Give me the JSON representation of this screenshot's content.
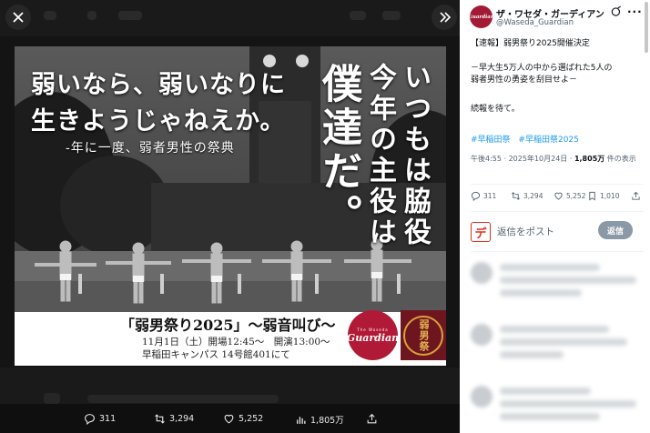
{
  "viewer": {
    "close_icon": "close-icon",
    "expand_icon": "double-chevron-right-icon",
    "poster": {
      "headline": "弱いなら、弱いなりに\n生きようじゃねえか。",
      "subline": "-年に一度、弱者男性の祭典",
      "vertical_1": "いつもは脇役",
      "vertical_2": "今年の主役は",
      "vertical_3": "僕達だ。",
      "event_title": "「弱男祭り2025」～弱音叫び～",
      "event_line_1": "11月1日（土）開場12:45～　開演13:00～",
      "event_line_2": "早稲田キャンパス 14号館401にて",
      "logo_small": "The Waseda",
      "logo_big": "Guardian",
      "logo_seal": "弱男祭"
    },
    "actions": {
      "replies": "311",
      "reposts": "3,294",
      "likes": "5,252",
      "views": "1,805万"
    }
  },
  "panel": {
    "account_name": "ザ・ワセダ・ガーディアン",
    "account_handle": "@Waseda_Guardian",
    "avatar_text": "Guardian",
    "post_line_1": "【速報】弱男祭り2025開催決定",
    "post_line_2": "－早大生5万人の中から選ばれた5人の",
    "post_line_3": "弱者男性の勇姿を刮目せよ－",
    "post_line_4": "続報を待て。",
    "hashtags": [
      "#早稲田祭",
      "#早稲田祭2025"
    ],
    "timestamp": "午後4:55 · 2025年10月24日 · ",
    "views_count": "1,805万",
    "views_label": " 件の表示",
    "stats": {
      "replies": "311",
      "reposts": "3,294",
      "likes": "5,252",
      "bookmarks": "1,010"
    },
    "reply_avatar": "デ",
    "reply_placeholder": "返信をポスト",
    "reply_button": "返信"
  },
  "colors": {
    "accent": "#1d9bf0",
    "brand_red": "#a31a35",
    "seal_dark": "#6e1620",
    "reply_button": "#8b98a5"
  }
}
